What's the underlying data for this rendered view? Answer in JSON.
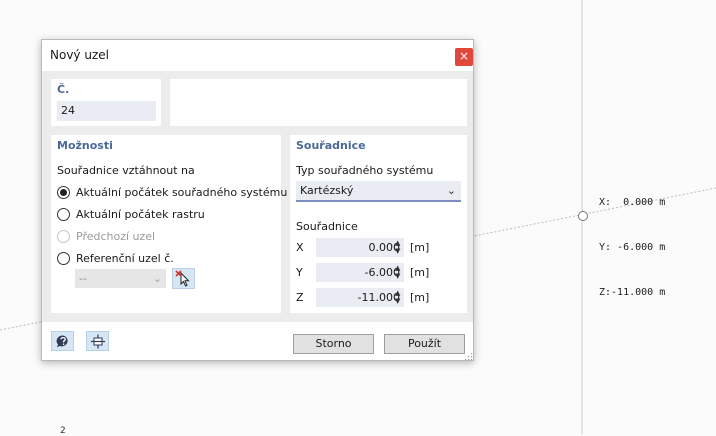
{
  "dialog": {
    "title": "Nový uzel",
    "close_label": "×"
  },
  "number": {
    "label": "Č.",
    "value": "24"
  },
  "options": {
    "title": "Možnosti",
    "heading": "Souřadnice vztáhnout na",
    "items": [
      {
        "label": "Aktuální počátek souřadného systému",
        "checked": true,
        "disabled": false
      },
      {
        "label": "Aktuální počátek rastru",
        "checked": false,
        "disabled": false
      },
      {
        "label": "Předchozí uzel",
        "checked": false,
        "disabled": true
      },
      {
        "label": "Referenční uzel č.",
        "checked": false,
        "disabled": false
      }
    ],
    "reference_value": "--",
    "reference_chevron": "⌄"
  },
  "coordinates": {
    "title": "Souřadnice",
    "system_label": "Typ souřadného systému",
    "system_value": "Kartézský",
    "system_chevron": "⌄",
    "values_label": "Souřadnice",
    "rows": [
      {
        "axis": "X",
        "value": "0.000",
        "unit": "[m]"
      },
      {
        "axis": "Y",
        "value": "-6.000",
        "unit": "[m]"
      },
      {
        "axis": "Z",
        "value": "-11.000",
        "unit": "[m]"
      }
    ]
  },
  "buttons": {
    "cancel": "Storno",
    "apply": "Použít"
  },
  "viewport": {
    "cursor_readout": [
      "X:  0.000 m",
      "Y: -6.000 m",
      "Z:-11.000 m"
    ],
    "stray_mark": "2"
  },
  "colors": {
    "accent": "#4a6898",
    "close": "#e0483c",
    "icon_button_bg": "#d6e6f5"
  },
  "icons": {
    "help": "help-icon",
    "snap": "snap-icon",
    "pick": "pick-node-icon"
  }
}
